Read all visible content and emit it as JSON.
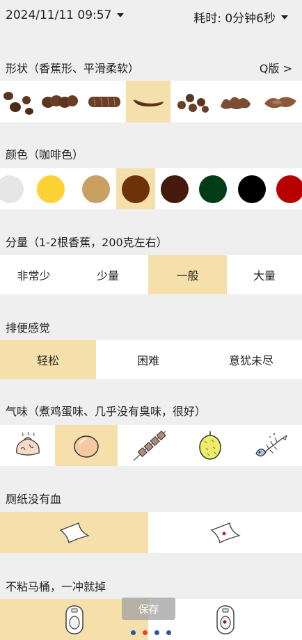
{
  "header": {
    "datetime": "2024/11/11 09:57",
    "duration": "耗时: 0分钟6秒"
  },
  "shape": {
    "title": "形状（香蕉形、平滑柔软）",
    "mode_link": "Q版 >",
    "options": [
      "hard-lumps-icon",
      "lumpy-sausage-icon",
      "cracked-sausage-icon",
      "smooth-banana-icon",
      "soft-blobs-icon",
      "mushy-icon",
      "watery-icon"
    ],
    "selected_index": 3
  },
  "color": {
    "title": "颜色（咖啡色）",
    "swatches": [
      "#e6e6e6",
      "#fdd235",
      "#c9a062",
      "#6e3108",
      "#451a0d",
      "#003d16",
      "#000000",
      "#b80000"
    ],
    "selected_index": 3
  },
  "amount": {
    "title": "分量（1-2根香蕉，200克左右）",
    "options": [
      "非常少",
      "少量",
      "一般",
      "大量"
    ],
    "selected_index": 2
  },
  "feeling": {
    "title": "排便感觉",
    "options": [
      "轻松",
      "困难",
      "意犹未尽"
    ],
    "selected_index": 0
  },
  "smell": {
    "title": "气味（煮鸡蛋味、几乎没有臭味，很好）",
    "options": [
      "bun-icon",
      "egg-icon",
      "skewer-icon",
      "durian-icon",
      "fish-bone-icon"
    ],
    "selected_index": 1
  },
  "blood": {
    "title": "厕纸没有血",
    "options": [
      "clean-tissue-icon",
      "blood-tissue-icon"
    ],
    "selected_index": 0
  },
  "toilet": {
    "title": "不粘马桶，一冲就掉",
    "options": [
      "clean-toilet-icon",
      "stained-toilet-icon"
    ],
    "selected_index": 0
  },
  "save_label": "保存",
  "pager": {
    "count": 4,
    "active_index": 1,
    "active_color": "#e2453c",
    "inactive_color": "#2b56a8"
  }
}
